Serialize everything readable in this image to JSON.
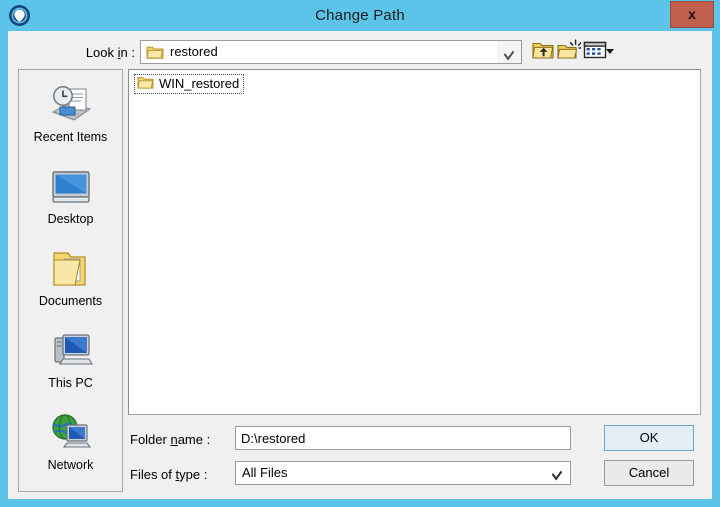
{
  "window": {
    "title": "Change Path",
    "app_icon": "target-circle-icon",
    "close_label": "x",
    "frame_color": "#5cc4e8",
    "titlebar_color": "#5cc4e8",
    "body_color": "#f0f0f0",
    "close_button_color": "#c1604f"
  },
  "lookin": {
    "label": "Look in :",
    "label_mnemonic": "i",
    "value": "restored",
    "icon": "folder-icon"
  },
  "toolbar": {
    "buttons": [
      {
        "name": "up-one-level",
        "icon": "folder-up-arrow-icon",
        "title": "Up One Level"
      },
      {
        "name": "new-folder",
        "icon": "new-folder-icon",
        "title": "Create New Folder"
      },
      {
        "name": "view-menu",
        "icon": "details-view-icon",
        "title": "View Menu"
      }
    ]
  },
  "places": {
    "items": [
      {
        "label": "Recent Items",
        "icon": "recent-items-icon"
      },
      {
        "label": "Desktop",
        "icon": "desktop-monitor-icon"
      },
      {
        "label": "Documents",
        "icon": "documents-folder-icon"
      },
      {
        "label": "This PC",
        "icon": "this-pc-computer-icon"
      },
      {
        "label": "Network",
        "icon": "network-globe-icon"
      }
    ]
  },
  "file_list": {
    "entries": [
      {
        "name": "WIN_restored",
        "icon": "folder-icon",
        "selected": true,
        "focused": true
      }
    ]
  },
  "form": {
    "folder_name_label": "Folder name :",
    "folder_name_mnemonic": "n",
    "folder_name_value": "D:\\restored",
    "folder_name_placeholder": "",
    "files_of_type_label": "Files of type :",
    "files_of_type_mnemonic": "t",
    "files_of_type_value": "All Files"
  },
  "buttons": {
    "ok_label": "OK",
    "cancel_label": "Cancel",
    "ok_accent": "#6aa7c9"
  }
}
